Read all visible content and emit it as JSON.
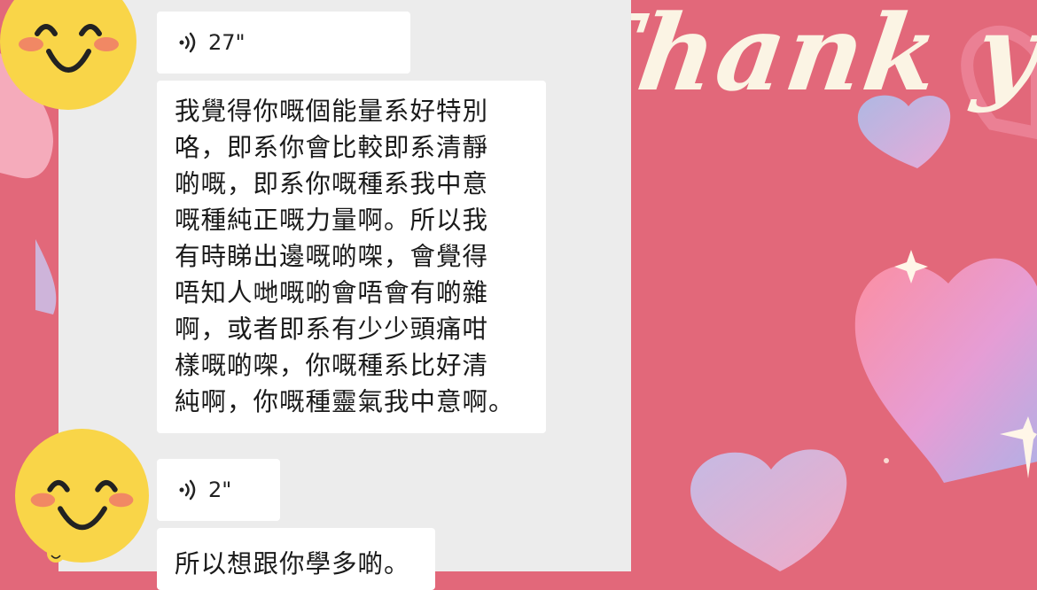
{
  "decoration": {
    "headline": "Thank you"
  },
  "messages": [
    {
      "type": "voice",
      "duration": "27\""
    },
    {
      "type": "text",
      "lines": [
        "我覺得你嘅個能量系好特別",
        "咯，即系你會比較即系清靜",
        "啲嘅，即系你嘅種系我中意",
        "嘅種純正嘅力量啊。所以我",
        "有時睇出邊嘅啲㗎，會覺得",
        "唔知人哋嘅啲會唔會有啲雜",
        "啊，或者即系有少少頭痛咁",
        "樣嘅啲㗎，你嘅種系比好清",
        "純啊，你嘅種靈氣我中意啊。"
      ]
    },
    {
      "type": "voice",
      "duration": "2\""
    },
    {
      "type": "text",
      "lines": [
        "所以想跟你學多啲。"
      ]
    }
  ],
  "icons": {
    "avatar": "smiley-face-icon",
    "voice": "voice-wave-icon",
    "sparkle": "sparkle-icon",
    "heart": "heart-icon"
  },
  "colors": {
    "background": "#e2687a",
    "chat_panel": "#ececec",
    "bubble": "#ffffff",
    "avatar_face": "#f9d548",
    "headline": "#fbf4e4"
  }
}
